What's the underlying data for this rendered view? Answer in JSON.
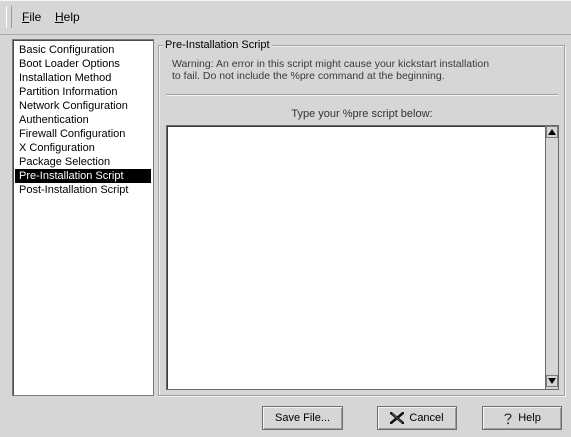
{
  "menubar": {
    "file": {
      "mnemonic": "F",
      "rest": "ile"
    },
    "help": {
      "mnemonic": "H",
      "rest": "elp"
    }
  },
  "sidebar": {
    "items": [
      "Basic Configuration",
      "Boot Loader Options",
      "Installation Method",
      "Partition Information",
      "Network Configuration",
      "Authentication",
      "Firewall Configuration",
      "X Configuration",
      "Package Selection",
      "Pre-Installation Script",
      "Post-Installation Script"
    ],
    "selected_index": 9
  },
  "section": {
    "title": "Pre-Installation Script",
    "warning_line1": "Warning: An error in this script might cause your kickstart installation",
    "warning_line2": "to fail. Do not include the %pre command at the beginning.",
    "prompt": "Type your %pre script below:",
    "script_value": ""
  },
  "buttons": {
    "save": "Save File...",
    "cancel": "Cancel",
    "help": "Help"
  },
  "icons": {
    "cancel": "x-mark-icon",
    "help": "question-icon"
  }
}
